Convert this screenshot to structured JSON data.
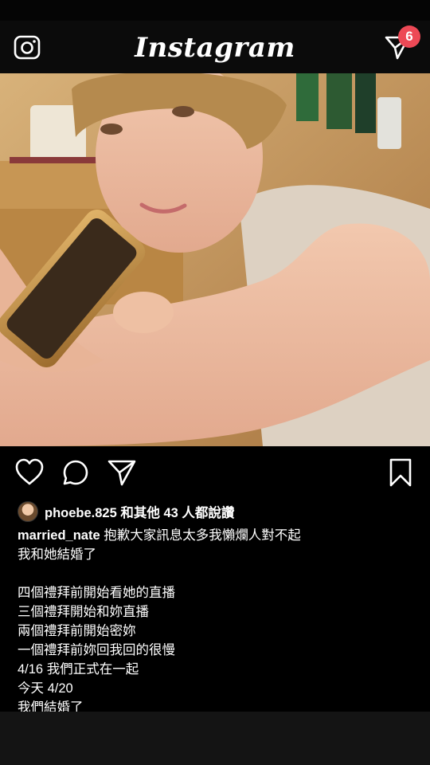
{
  "header": {
    "logo": "Instagram",
    "notification_count": "6"
  },
  "post": {
    "liked_by_user": "phoebe.825",
    "liked_by_rest": "和其他 43 人都說讚",
    "author": "married_nate",
    "caption_first": "抱歉大家訊息太多我懶爛人對不起",
    "caption_lines": [
      "我和她結婚了",
      "",
      "四個禮拜前開始看她的直播",
      "三個禮拜開始和妳直播",
      "兩個禮拜前開始密妳",
      "一個禮拜前妳回我回的很慢",
      "4/16 我們正式在一起",
      "今天 4/20",
      "我們結婚了"
    ]
  },
  "icons": {
    "camera": "camera-icon",
    "direct": "paper-plane-icon",
    "like": "heart-icon",
    "comment": "comment-icon",
    "share": "share-icon",
    "save": "bookmark-icon"
  },
  "colors": {
    "background": "#000000",
    "badge": "#ed4956"
  }
}
